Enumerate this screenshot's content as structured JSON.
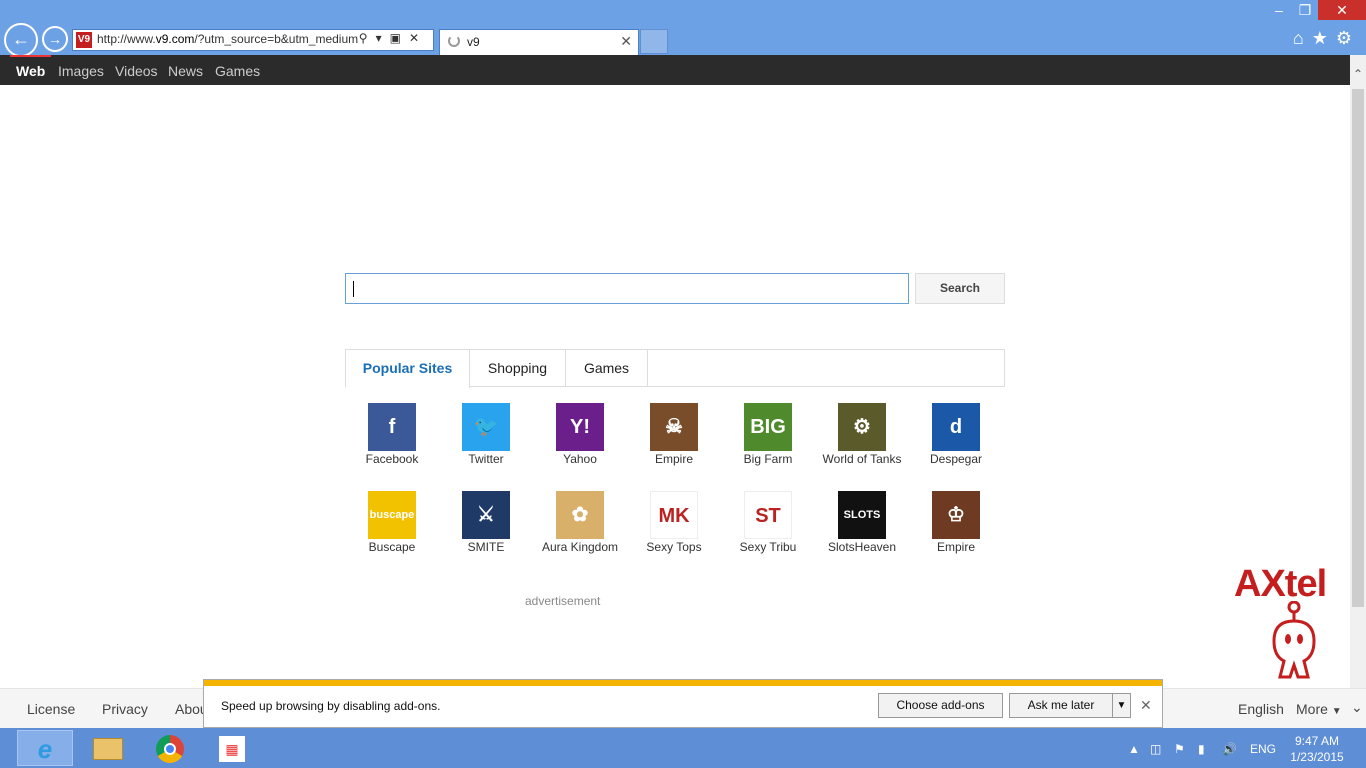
{
  "browser": {
    "url_prefix": "http://www.",
    "url_domain": "v9.com",
    "url_rest": "/?utm_source=b&utm_medium",
    "favicon": "V9",
    "tab_title": "v9",
    "icons": {
      "back": "arrow-left-icon",
      "forward": "arrow-right-icon",
      "home": "home-icon",
      "favorites": "star-icon",
      "tools": "gear-icon"
    }
  },
  "sitenav": {
    "items": [
      "Web",
      "Images",
      "Videos",
      "News",
      "Games"
    ]
  },
  "search": {
    "value": "",
    "button_label": "Search"
  },
  "tabs": [
    "Popular Sites",
    "Shopping",
    "Games"
  ],
  "tiles": [
    {
      "label": "Facebook",
      "icon": "f",
      "color": "#3b5998"
    },
    {
      "label": "Twitter",
      "icon": "🐦",
      "color": "#2aa3ef"
    },
    {
      "label": "Yahoo",
      "icon": "Y!",
      "color": "#6b1f8a"
    },
    {
      "label": "Empire",
      "icon": "☠",
      "color": "#7a4d2a"
    },
    {
      "label": "Big Farm",
      "icon": "BIG",
      "color": "#4f8a2d"
    },
    {
      "label": "World of Tanks",
      "icon": "⚙",
      "color": "#5a5a2a"
    },
    {
      "label": "Despegar",
      "icon": "d",
      "color": "#1c58a8"
    },
    {
      "label": "Buscape",
      "icon": "buscape",
      "color": "#f2c200"
    },
    {
      "label": "SMITE",
      "icon": "⚔",
      "color": "#1f3a66"
    },
    {
      "label": "Aura Kingdom",
      "icon": "✿",
      "color": "#d8b06a"
    },
    {
      "label": "Sexy Tops",
      "icon": "MK",
      "color": "#ffffff"
    },
    {
      "label": "Sexy Tribu",
      "icon": "ST",
      "color": "#ffffff"
    },
    {
      "label": "SlotsHeaven",
      "icon": "SLOTS",
      "color": "#111111"
    },
    {
      "label": "Empire",
      "icon": "♔",
      "color": "#6e3a22"
    }
  ],
  "advertisement": "advertisement",
  "axtel": "AXtel",
  "footer": {
    "license": "License",
    "privacy": "Privacy",
    "about": "Abou",
    "language": "English",
    "more": "More"
  },
  "notification": {
    "text": "Speed up browsing by disabling add-ons.",
    "choose": "Choose add-ons",
    "later": "Ask me later"
  },
  "taskbar": {
    "lang": "ENG",
    "time": "9:47 AM",
    "date": "1/23/2015"
  }
}
